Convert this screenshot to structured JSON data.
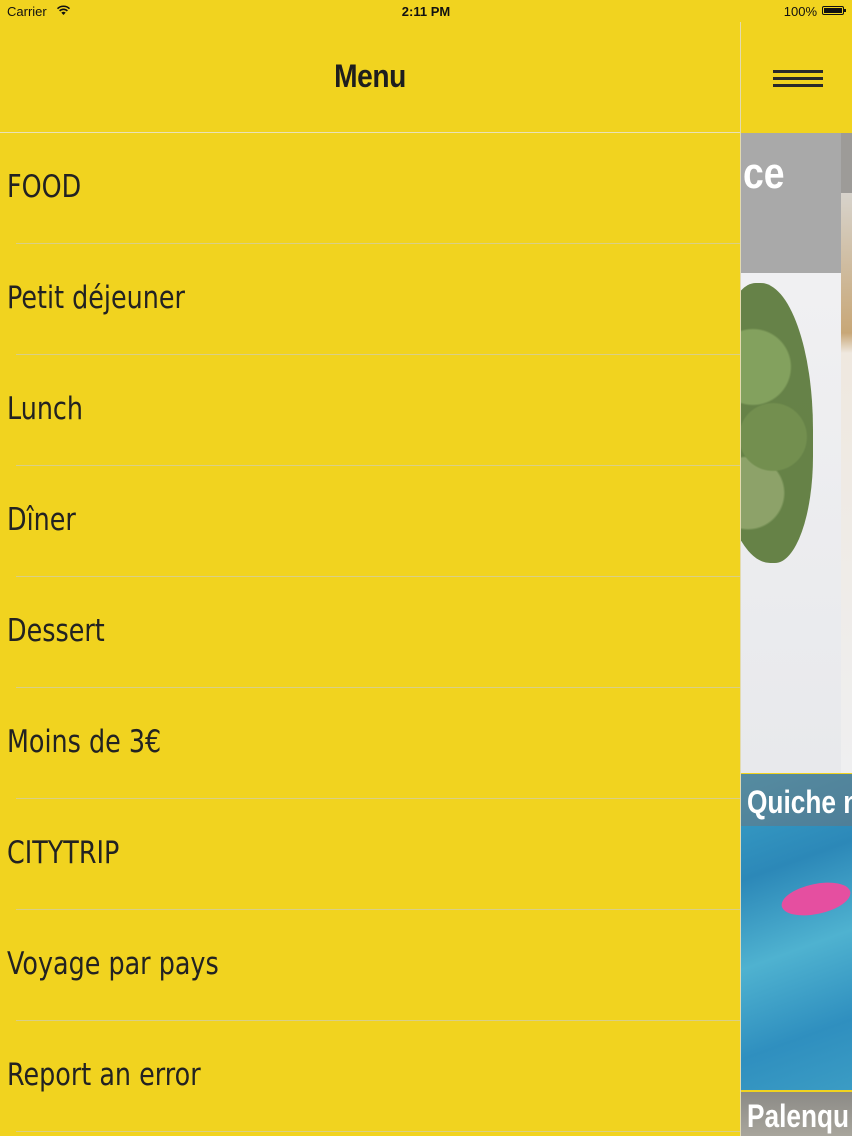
{
  "status_bar": {
    "carrier": "Carrier",
    "time": "2:11 PM",
    "battery": "100%"
  },
  "drawer": {
    "title": "Menu",
    "items": [
      {
        "label": "FOOD"
      },
      {
        "label": "Petit déjeuner"
      },
      {
        "label": "Lunch"
      },
      {
        "label": "Dîner"
      },
      {
        "label": "Dessert"
      },
      {
        "label": "Moins de 3€"
      },
      {
        "label": "CITYTRIP"
      },
      {
        "label": "Voyage par pays"
      },
      {
        "label": "Report an error"
      }
    ]
  },
  "content_peek": {
    "menu_icon": "hamburger-icon",
    "cards": [
      {
        "title": "ce"
      },
      {
        "title": "Quiche n"
      },
      {
        "title": "Palenqu"
      }
    ]
  },
  "colors": {
    "accent": "#f1d31f",
    "text": "#222222"
  }
}
